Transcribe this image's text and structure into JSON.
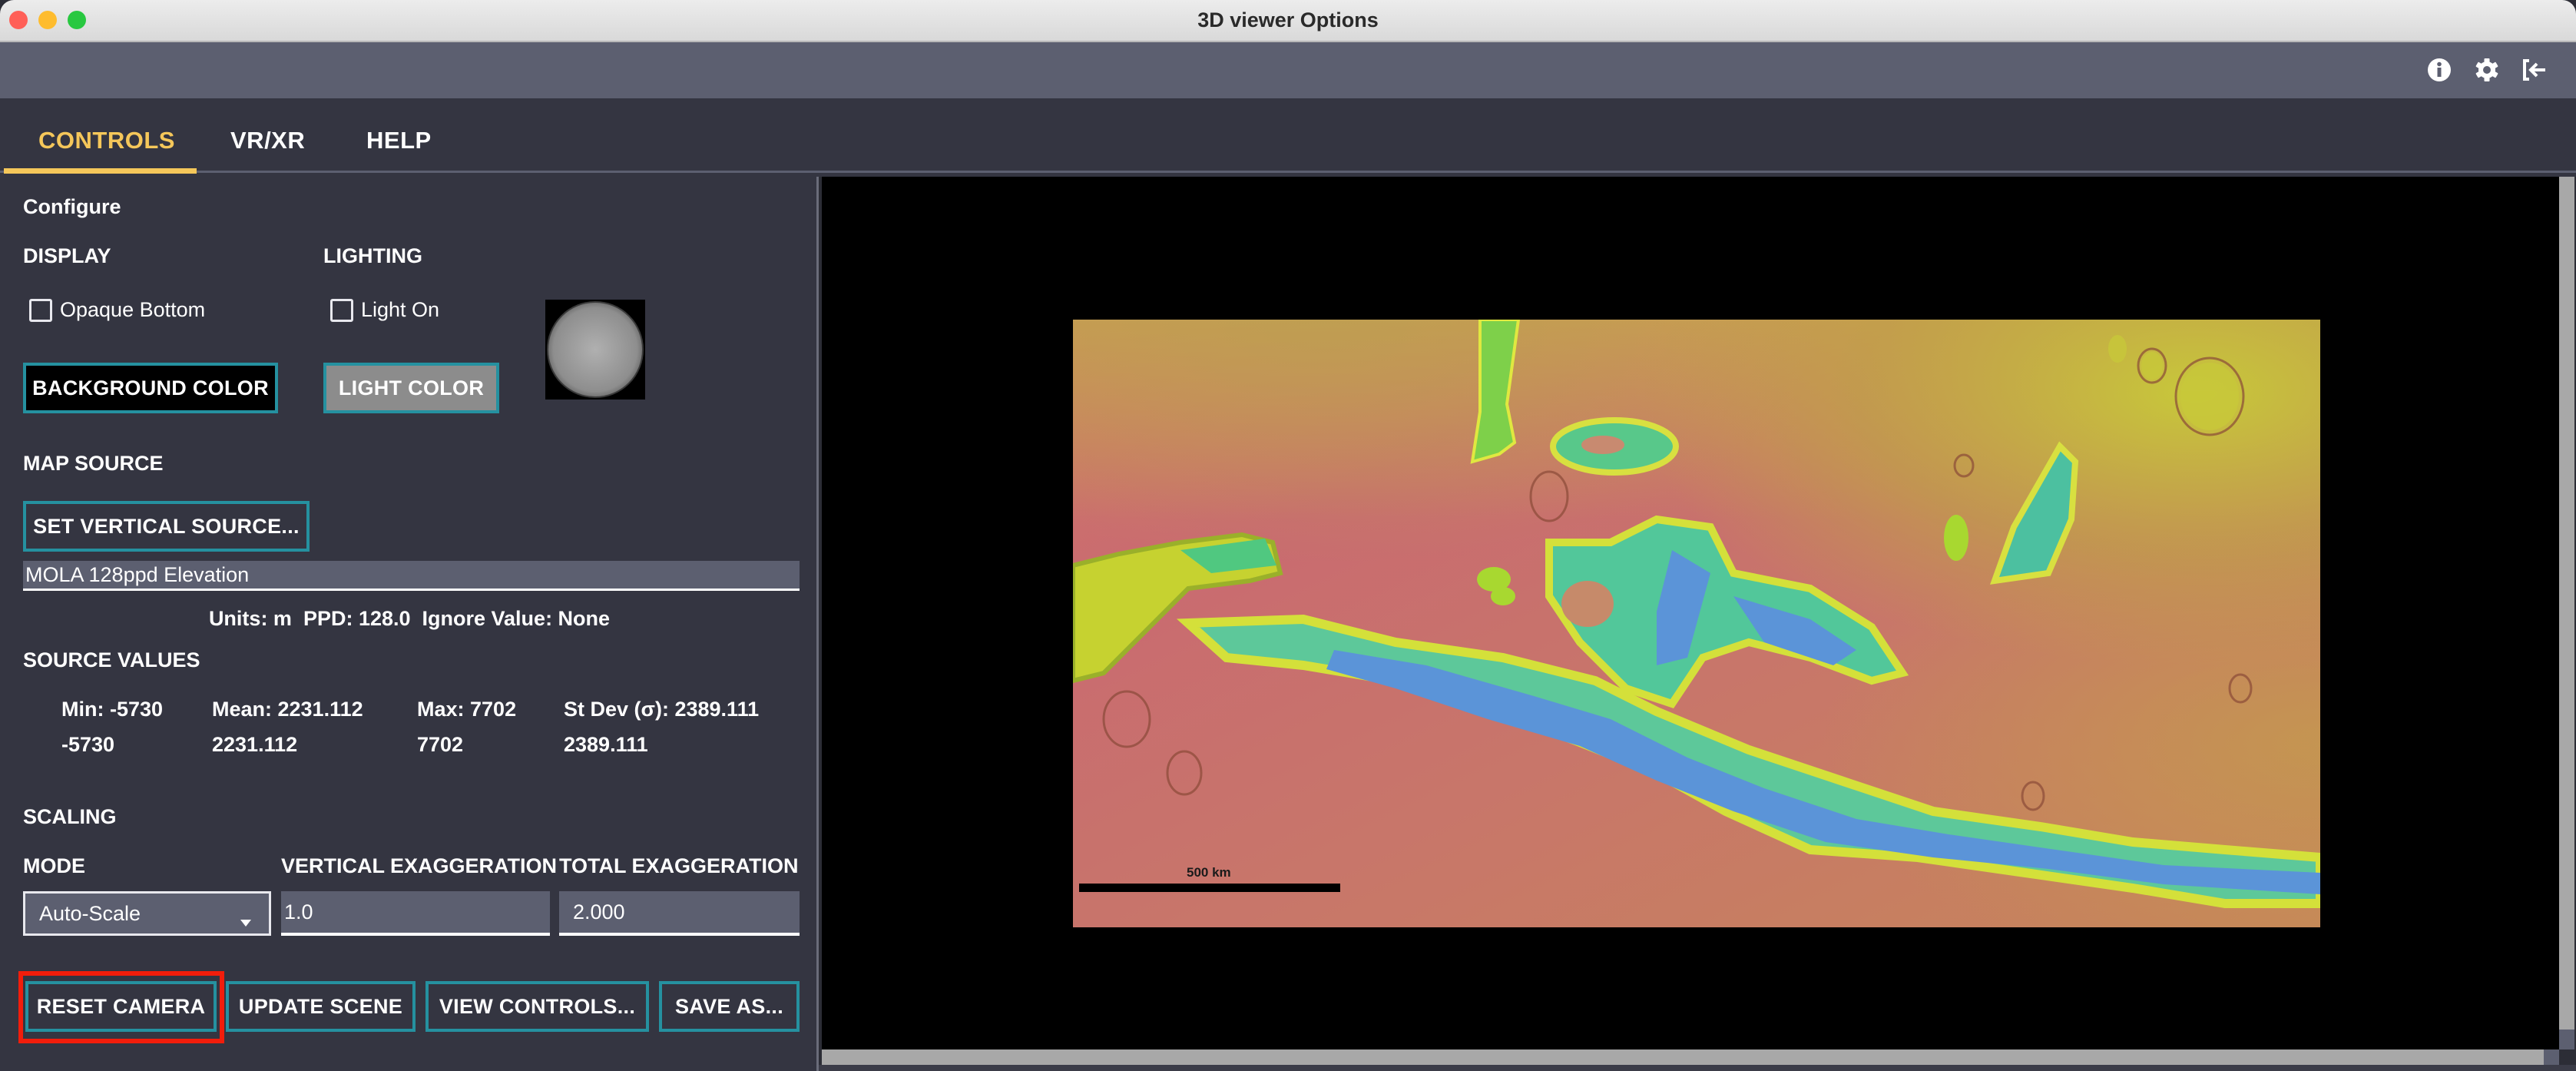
{
  "window": {
    "title": "3D viewer Options",
    "traffic_lights": {
      "close": "#ff5f57",
      "minimize": "#febc2e",
      "maximize": "#28c840"
    }
  },
  "toolbar": {
    "icons": [
      {
        "name": "info-icon",
        "glyph": "i"
      },
      {
        "name": "gear-icon",
        "glyph": "⚙"
      },
      {
        "name": "logout-icon",
        "glyph": "⇤"
      }
    ]
  },
  "tabs": [
    {
      "label": "CONTROLS",
      "active": true
    },
    {
      "label": "VR/XR",
      "active": false
    },
    {
      "label": "HELP",
      "active": false
    }
  ],
  "colors": {
    "accent": "#f5c75a",
    "button_border": "#2591a0",
    "panel_bg": "#343541",
    "toolbar_bg": "#5c5f70",
    "highlight": "#f21d0b"
  },
  "controls": {
    "configure_title": "Configure",
    "display": {
      "heading": "DISPLAY",
      "opaque_bottom_label": "Opaque Bottom",
      "opaque_bottom_checked": false,
      "background_color_button": "BACKGROUND COLOR",
      "background_color": "#000000"
    },
    "lighting": {
      "heading": "LIGHTING",
      "light_on_label": "Light On",
      "light_on_checked": false,
      "light_color_button": "LIGHT COLOR",
      "light_color": "#8c8c8c"
    },
    "map_source": {
      "heading": "MAP SOURCE",
      "set_vertical_source_button": "SET VERTICAL SOURCE...",
      "source_name": "MOLA 128ppd Elevation",
      "info_line": "Units: m  PPD: 128.0  Ignore Value: None"
    },
    "source_values": {
      "heading": "SOURCE VALUES",
      "labels": [
        "Min: -5730",
        "Mean: 2231.112",
        "Max: 7702",
        "St Dev (σ): 2389.111"
      ],
      "values": [
        "-5730",
        "2231.112",
        "7702",
        "2389.111"
      ]
    },
    "scaling": {
      "heading": "SCALING",
      "mode_label": "MODE",
      "mode_value": "Auto-Scale",
      "vertical_exaggeration_label": "VERTICAL EXAGGERATION",
      "vertical_exaggeration_value": "1.0",
      "total_exaggeration_label": "TOTAL EXAGGERATION",
      "total_exaggeration_value": "2.000"
    },
    "actions": {
      "reset_camera": "RESET CAMERA",
      "update_scene": "UPDATE SCENE",
      "view_controls": "VIEW CONTROLS...",
      "save_as": "SAVE AS..."
    }
  },
  "viewport": {
    "scale_bar_label": "500 km"
  }
}
